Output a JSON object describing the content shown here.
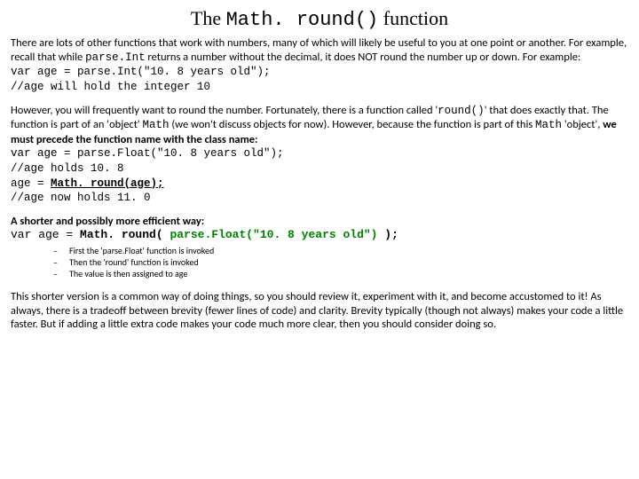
{
  "title_pre": "The ",
  "title_code": "Math. round()",
  "title_post": " function",
  "p1a": "There are lots of other functions that work with numbers, many of which will likely be useful to you at one point or another. For example, recall that while ",
  "p1b": "parse.Int",
  "p1c": " returns a number without the decimal, it does NOT round the number up or down. For example:",
  "c1l1": "var age = parse.Int(\"10. 8 years old\");",
  "c1l2": "//age will hold the integer 10",
  "p2a": "However, you will frequently want to round the number. Fortunately, there is a function called '",
  "p2b": "round()",
  "p2c": "' that does exactly that. The function is part of an 'object' ",
  "p2d": "Math",
  "p2e": " (we won't discuss objects for now). However, because the function is part of this ",
  "p2f": "Math",
  "p2g": " 'object', ",
  "p2h": "we must precede the function name with the class name:",
  "c2l1": "var age = parse.Float(\"10. 8 years old\");",
  "c2l2": "//age holds 10. 8",
  "c2l3a": "age = ",
  "c2l3b": "Math. round(age);",
  "c2l4": "//age now holds 11. 0",
  "p3head": "A shorter and possibly more efficient way:",
  "p3codea": "var age = ",
  "p3codeb": "Math. round(  ",
  "p3codec": "parse.Float(\"10. 8 years old\")",
  "p3coded": "  );",
  "b1": "First the 'parse.Float' function is invoked",
  "b2": "Then the 'round' function is invoked",
  "b3": "The value is then assigned to age",
  "p4": "This shorter version is a common way of doing things, so you should review it, experiment with it, and become accustomed to it! As always, there is a tradeoff between brevity (fewer lines of code) and clarity. Brevity typically (though not always) makes your code a little faster. But if adding a little extra code makes your code much more clear, then you should consider doing so."
}
